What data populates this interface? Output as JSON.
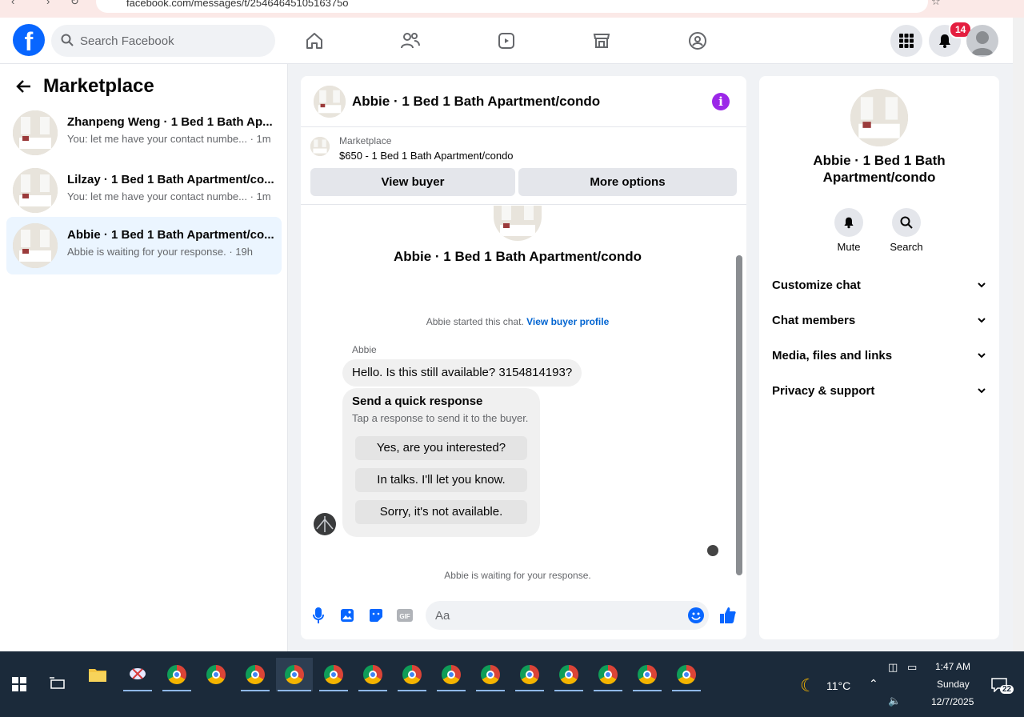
{
  "browser": {
    "url": "facebook.com/messages/t/2546464510516375o"
  },
  "topbar": {
    "search_placeholder": "Search Facebook",
    "notification_count": "14"
  },
  "left": {
    "title": "Marketplace",
    "conversations": [
      {
        "name": "Zhanpeng Weng · 1 Bed 1 Bath Ap...",
        "snippet": "You: let me have your contact numbe... · 1m"
      },
      {
        "name": "Lilzay · 1 Bed 1 Bath Apartment/co...",
        "snippet": "You: let me have your contact numbe... · 1m"
      },
      {
        "name": "Abbie · 1 Bed 1 Bath Apartment/co...",
        "snippet": "Abbie is waiting for your response. · 19h"
      }
    ]
  },
  "chat": {
    "header_name": "Abbie · 1 Bed 1 Bath Apartment/condo",
    "marketplace_label": "Marketplace",
    "listing": "$650 - 1 Bed 1 Bath Apartment/condo",
    "view_buyer": "View buyer",
    "more_options": "More options",
    "title": "Abbie · 1 Bed 1 Bath Apartment/condo",
    "started_text": "Abbie started this chat.",
    "view_profile": "View buyer profile",
    "sender": "Abbie",
    "message": "Hello. Is this still available? 3154814193?",
    "quick_title": "Send a quick response",
    "quick_sub": "Tap a response to send it to the buyer.",
    "quick_options": [
      "Yes, are you interested?",
      "In talks. I'll let you know.",
      "Sorry, it's not available."
    ],
    "waiting": "Abbie is waiting for your response.",
    "input_placeholder": "Aa"
  },
  "right": {
    "name": "Abbie · 1 Bed 1 Bath Apartment/condo",
    "mute": "Mute",
    "search": "Search",
    "sections": [
      "Customize chat",
      "Chat members",
      "Media, files and links",
      "Privacy & support"
    ]
  },
  "taskbar": {
    "temperature": "11°C",
    "time": "1:47 AM",
    "day": "Sunday",
    "date": "12/7/2025",
    "notif_count": "22"
  }
}
